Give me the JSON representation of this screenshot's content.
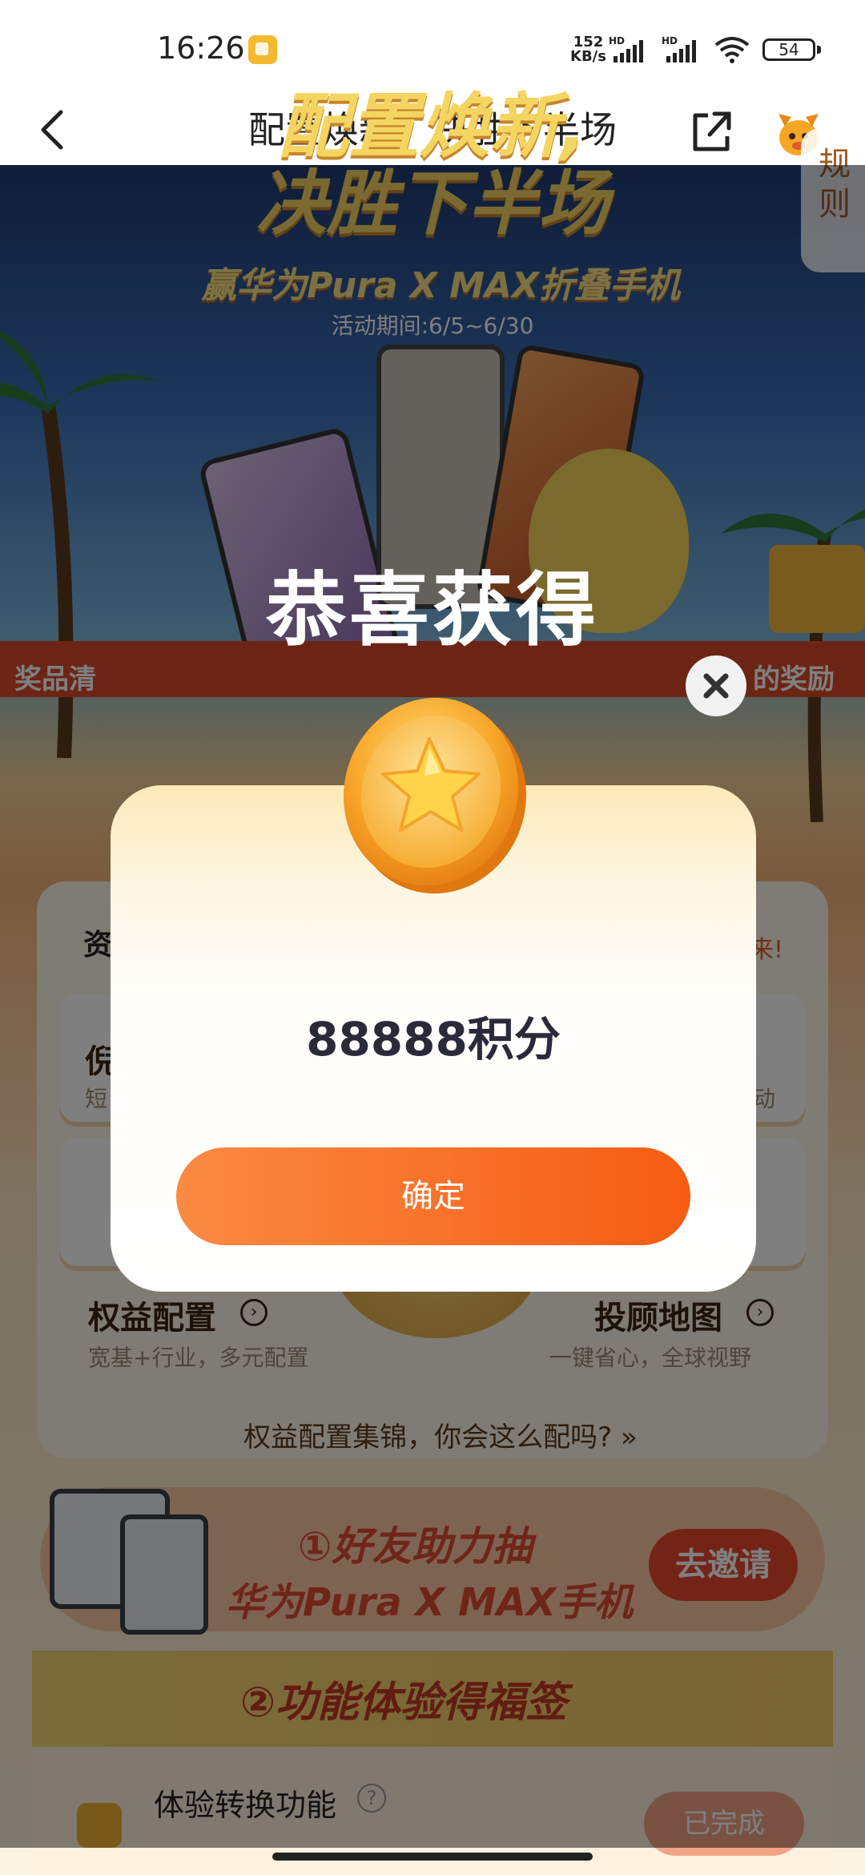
{
  "status_bar": {
    "time": "16:26",
    "net_speed_value": "152",
    "net_speed_unit": "KB/s",
    "signal1_label": "HD",
    "signal2_label": "HD",
    "battery": "54"
  },
  "header": {
    "title": "配置焕新，决胜下半场",
    "back_icon": "chevron-left-icon",
    "share_icon": "share-icon",
    "mascot_icon": "mascot-icon"
  },
  "background": {
    "hero_title_line1": "配置焕新,",
    "hero_title_line2": "决胜下半场",
    "hero_subtitle": "赢华为Pura X MAX折叠手机",
    "hero_period": "活动期间:6/5~6/30",
    "rules_tab": "规则",
    "ribbon_left": "奖品清",
    "ribbon_right": "的奖励",
    "config_heading_left": "资",
    "config_heading_right": "来!",
    "tile1_title": "权益配置",
    "tile1_desc": "宽基+行业，多元配置",
    "tile2_title": "投顾地图",
    "tile2_desc": "一键省心，全球视野",
    "tile3_title": "倪",
    "tile3_desc": "短",
    "tile4_desc": "动",
    "config_more": "权益配置集锦，你会这么配吗? »",
    "invite_line1": "①好友助力抽",
    "invite_line2": "华为Pura X MAX手机",
    "invite_button": "去邀请",
    "feature_title": "②功能体验得福签",
    "experience_title": "体验转换功能",
    "experience_button": "已完成",
    "colors": {
      "accent_orange": "#f65c13",
      "hero_gold": "#f4d562",
      "invite_red": "#e04a32"
    }
  },
  "modal": {
    "title": "恭喜获得",
    "coin_icon": "star-coin-icon",
    "reward": "88888积分",
    "confirm_label": "确定",
    "close_icon": "close-icon"
  }
}
